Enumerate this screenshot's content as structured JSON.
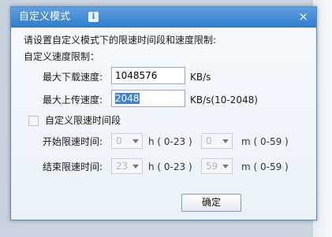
{
  "dialog": {
    "title": "自定义模式",
    "info_icon": "i",
    "close_glyph": "×",
    "instruction": "请设置自定义模式下的限速时间段和速度限制:",
    "speed_section_label": "自定义速度限制：",
    "download_label": "最大下载速度:",
    "download_value": "1048576",
    "download_unit": "KB/s",
    "upload_label": "最大上传速度:",
    "upload_value": "2048",
    "upload_unit": "KB/s(10-2048)",
    "time_checkbox_label": "自定义限速时间段",
    "time_checkbox_checked": false,
    "start_label": "开始限速时间:",
    "start_hour": "0",
    "start_hour_unit": "h ( 0-23 )",
    "start_minute": "0",
    "start_minute_unit": "m ( 0-59 )",
    "end_label": "结束限速时间:",
    "end_hour": "23",
    "end_hour_unit": "h ( 0-23 )",
    "end_minute": "59",
    "end_minute_unit": "m ( 0-59 )",
    "ok_label": "确定"
  },
  "colors": {
    "titlebar_top": "#5f9fe0",
    "titlebar_bottom": "#2f7bcc",
    "selection": "#3e82d4"
  },
  "icons": {
    "info": "info-icon",
    "close": "close-icon",
    "dropdown": "chevron-down-icon"
  }
}
